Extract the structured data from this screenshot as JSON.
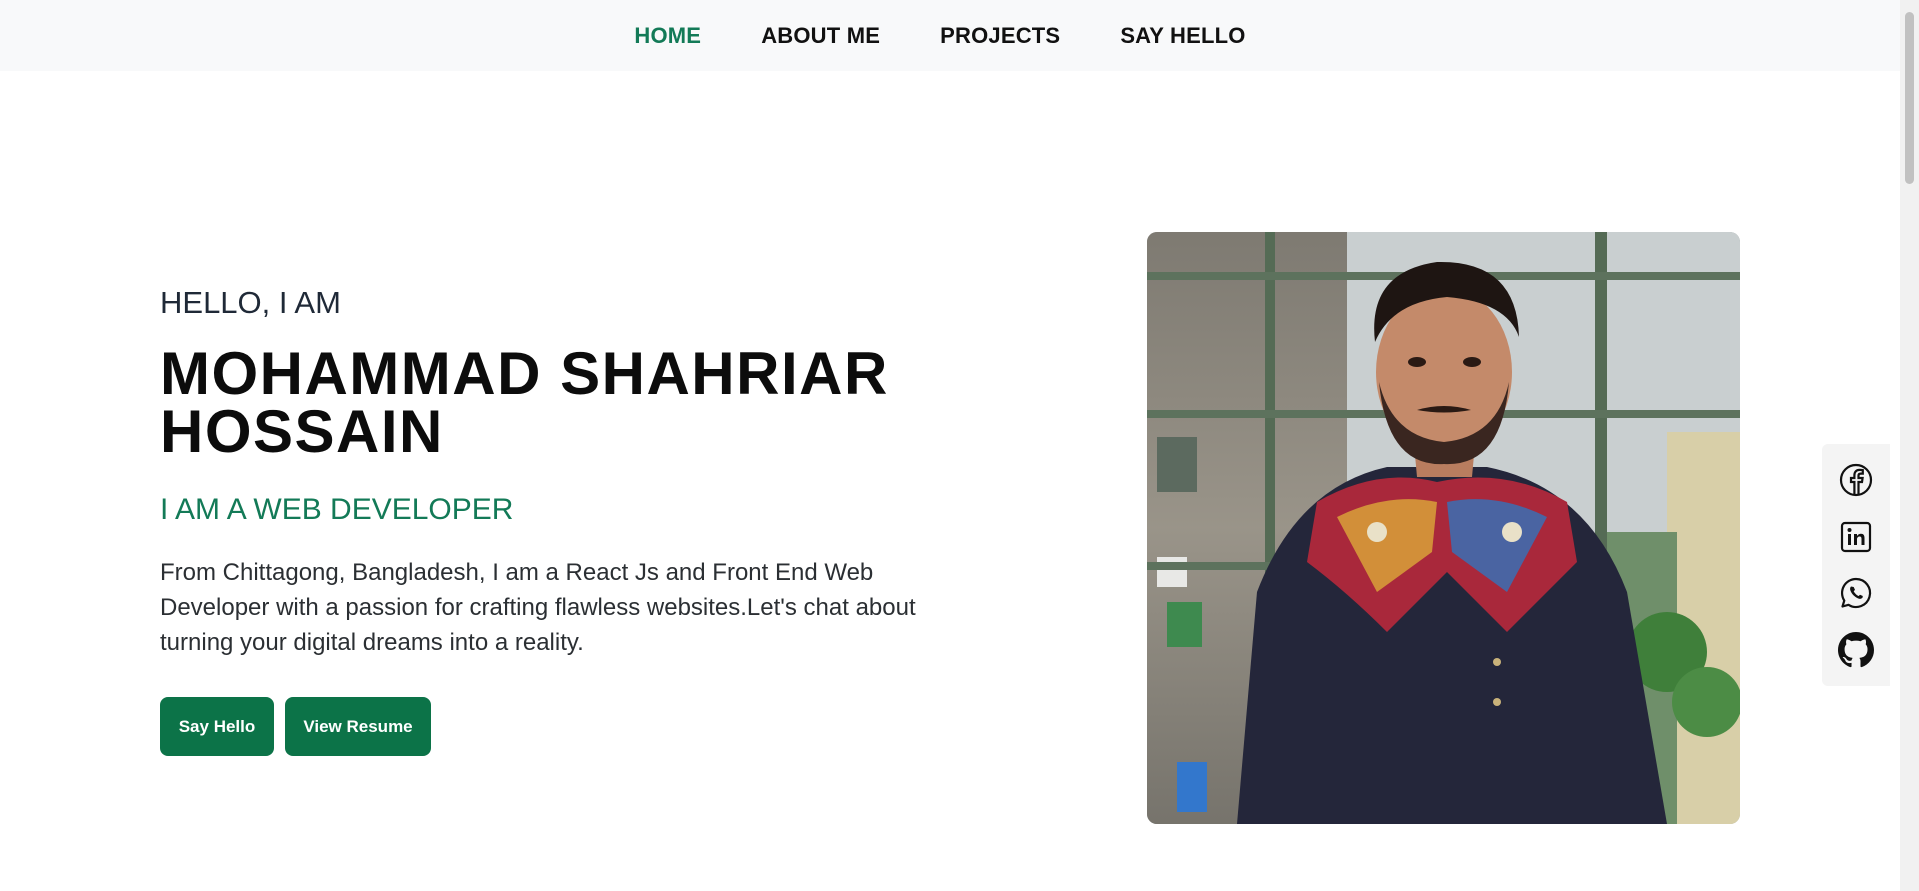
{
  "nav": {
    "items": [
      {
        "label": "HOME",
        "active": true
      },
      {
        "label": "ABOUT ME",
        "active": false
      },
      {
        "label": "PROJECTS",
        "active": false
      },
      {
        "label": "SAY HELLO",
        "active": false
      }
    ]
  },
  "hero": {
    "greeting": "HELLO, I AM",
    "name_line1": "MOHAMMAD SHAHRIAR",
    "name_line2": "HOSSAIN",
    "role": "I AM A WEB DEVELOPER",
    "bio": "From Chittagong, Bangladesh, I am a React Js and Front End Web Developer with a passion for crafting flawless websites.Let's chat about turning your digital dreams into a reality.",
    "buttons": {
      "say_hello": "Say Hello",
      "view_resume": "View Resume"
    }
  },
  "social": {
    "icons": [
      "facebook-icon",
      "linkedin-icon",
      "whatsapp-icon",
      "github-icon"
    ]
  },
  "colors": {
    "accent": "#137a57",
    "button": "#0c7348",
    "nav_bg": "#f8f9fa"
  }
}
